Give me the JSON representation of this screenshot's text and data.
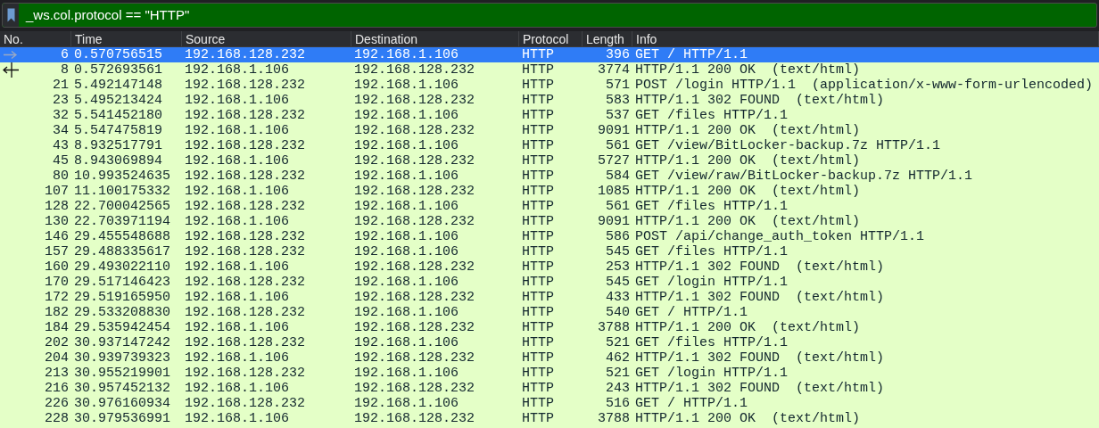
{
  "filter": {
    "value": "_ws.col.protocol == \"HTTP\""
  },
  "columns": [
    "No.",
    "Time",
    "Source",
    "Destination",
    "Protocol",
    "Length",
    "Info"
  ],
  "rows": [
    {
      "kind": "request",
      "no": "6",
      "time": "0.570756515",
      "source": "192.168.128.232",
      "destination": "192.168.1.106",
      "protocol": "HTTP",
      "length": "396",
      "info": "GET / HTTP/1.1",
      "selected": true
    },
    {
      "kind": "response",
      "no": "8",
      "time": "0.572693561",
      "source": "192.168.1.106",
      "destination": "192.168.128.232",
      "protocol": "HTTP",
      "length": "3774",
      "info": "HTTP/1.1 200 OK  (text/html)",
      "selected": false
    },
    {
      "kind": "other",
      "no": "21",
      "time": "5.492147148",
      "source": "192.168.128.232",
      "destination": "192.168.1.106",
      "protocol": "HTTP",
      "length": "571",
      "info": "POST /login HTTP/1.1  (application/x-www-form-urlencoded)",
      "selected": false
    },
    {
      "kind": "other",
      "no": "23",
      "time": "5.495213424",
      "source": "192.168.1.106",
      "destination": "192.168.128.232",
      "protocol": "HTTP",
      "length": "583",
      "info": "HTTP/1.1 302 FOUND  (text/html)",
      "selected": false
    },
    {
      "kind": "other",
      "no": "32",
      "time": "5.541452180",
      "source": "192.168.128.232",
      "destination": "192.168.1.106",
      "protocol": "HTTP",
      "length": "537",
      "info": "GET /files HTTP/1.1",
      "selected": false
    },
    {
      "kind": "other",
      "no": "34",
      "time": "5.547475819",
      "source": "192.168.1.106",
      "destination": "192.168.128.232",
      "protocol": "HTTP",
      "length": "9091",
      "info": "HTTP/1.1 200 OK  (text/html)",
      "selected": false
    },
    {
      "kind": "other",
      "no": "43",
      "time": "8.932517791",
      "source": "192.168.128.232",
      "destination": "192.168.1.106",
      "protocol": "HTTP",
      "length": "561",
      "info": "GET /view/BitLocker-backup.7z HTTP/1.1",
      "selected": false
    },
    {
      "kind": "other",
      "no": "45",
      "time": "8.943069894",
      "source": "192.168.1.106",
      "destination": "192.168.128.232",
      "protocol": "HTTP",
      "length": "5727",
      "info": "HTTP/1.1 200 OK  (text/html)",
      "selected": false
    },
    {
      "kind": "other",
      "no": "80",
      "time": "10.993524635",
      "source": "192.168.128.232",
      "destination": "192.168.1.106",
      "protocol": "HTTP",
      "length": "584",
      "info": "GET /view/raw/BitLocker-backup.7z HTTP/1.1",
      "selected": false
    },
    {
      "kind": "other",
      "no": "107",
      "time": "11.100175332",
      "source": "192.168.1.106",
      "destination": "192.168.128.232",
      "protocol": "HTTP",
      "length": "1085",
      "info": "HTTP/1.1 200 OK  (text/html)",
      "selected": false
    },
    {
      "kind": "other",
      "no": "128",
      "time": "22.700042565",
      "source": "192.168.128.232",
      "destination": "192.168.1.106",
      "protocol": "HTTP",
      "length": "561",
      "info": "GET /files HTTP/1.1",
      "selected": false
    },
    {
      "kind": "other",
      "no": "130",
      "time": "22.703971194",
      "source": "192.168.1.106",
      "destination": "192.168.128.232",
      "protocol": "HTTP",
      "length": "9091",
      "info": "HTTP/1.1 200 OK  (text/html)",
      "selected": false
    },
    {
      "kind": "other",
      "no": "146",
      "time": "29.455548688",
      "source": "192.168.128.232",
      "destination": "192.168.1.106",
      "protocol": "HTTP",
      "length": "586",
      "info": "POST /api/change_auth_token HTTP/1.1",
      "selected": false
    },
    {
      "kind": "other",
      "no": "157",
      "time": "29.488335617",
      "source": "192.168.128.232",
      "destination": "192.168.1.106",
      "protocol": "HTTP",
      "length": "545",
      "info": "GET /files HTTP/1.1",
      "selected": false
    },
    {
      "kind": "other",
      "no": "160",
      "time": "29.493022110",
      "source": "192.168.1.106",
      "destination": "192.168.128.232",
      "protocol": "HTTP",
      "length": "253",
      "info": "HTTP/1.1 302 FOUND  (text/html)",
      "selected": false
    },
    {
      "kind": "other",
      "no": "170",
      "time": "29.517146423",
      "source": "192.168.128.232",
      "destination": "192.168.1.106",
      "protocol": "HTTP",
      "length": "545",
      "info": "GET /login HTTP/1.1",
      "selected": false
    },
    {
      "kind": "other",
      "no": "172",
      "time": "29.519165950",
      "source": "192.168.1.106",
      "destination": "192.168.128.232",
      "protocol": "HTTP",
      "length": "433",
      "info": "HTTP/1.1 302 FOUND  (text/html)",
      "selected": false
    },
    {
      "kind": "other",
      "no": "182",
      "time": "29.533208830",
      "source": "192.168.128.232",
      "destination": "192.168.1.106",
      "protocol": "HTTP",
      "length": "540",
      "info": "GET / HTTP/1.1",
      "selected": false
    },
    {
      "kind": "other",
      "no": "184",
      "time": "29.535942454",
      "source": "192.168.1.106",
      "destination": "192.168.128.232",
      "protocol": "HTTP",
      "length": "3788",
      "info": "HTTP/1.1 200 OK  (text/html)",
      "selected": false
    },
    {
      "kind": "other",
      "no": "202",
      "time": "30.937147242",
      "source": "192.168.128.232",
      "destination": "192.168.1.106",
      "protocol": "HTTP",
      "length": "521",
      "info": "GET /files HTTP/1.1",
      "selected": false
    },
    {
      "kind": "other",
      "no": "204",
      "time": "30.939739323",
      "source": "192.168.1.106",
      "destination": "192.168.128.232",
      "protocol": "HTTP",
      "length": "462",
      "info": "HTTP/1.1 302 FOUND  (text/html)",
      "selected": false
    },
    {
      "kind": "other",
      "no": "213",
      "time": "30.955219901",
      "source": "192.168.128.232",
      "destination": "192.168.1.106",
      "protocol": "HTTP",
      "length": "521",
      "info": "GET /login HTTP/1.1",
      "selected": false
    },
    {
      "kind": "other",
      "no": "216",
      "time": "30.957452132",
      "source": "192.168.1.106",
      "destination": "192.168.128.232",
      "protocol": "HTTP",
      "length": "243",
      "info": "HTTP/1.1 302 FOUND  (text/html)",
      "selected": false
    },
    {
      "kind": "other",
      "no": "226",
      "time": "30.976160934",
      "source": "192.168.128.232",
      "destination": "192.168.1.106",
      "protocol": "HTTP",
      "length": "516",
      "info": "GET / HTTP/1.1",
      "selected": false
    },
    {
      "kind": "other",
      "no": "228",
      "time": "30.979536991",
      "source": "192.168.1.106",
      "destination": "192.168.128.232",
      "protocol": "HTTP",
      "length": "3788",
      "info": "HTTP/1.1 200 OK  (text/html)",
      "selected": false
    }
  ]
}
